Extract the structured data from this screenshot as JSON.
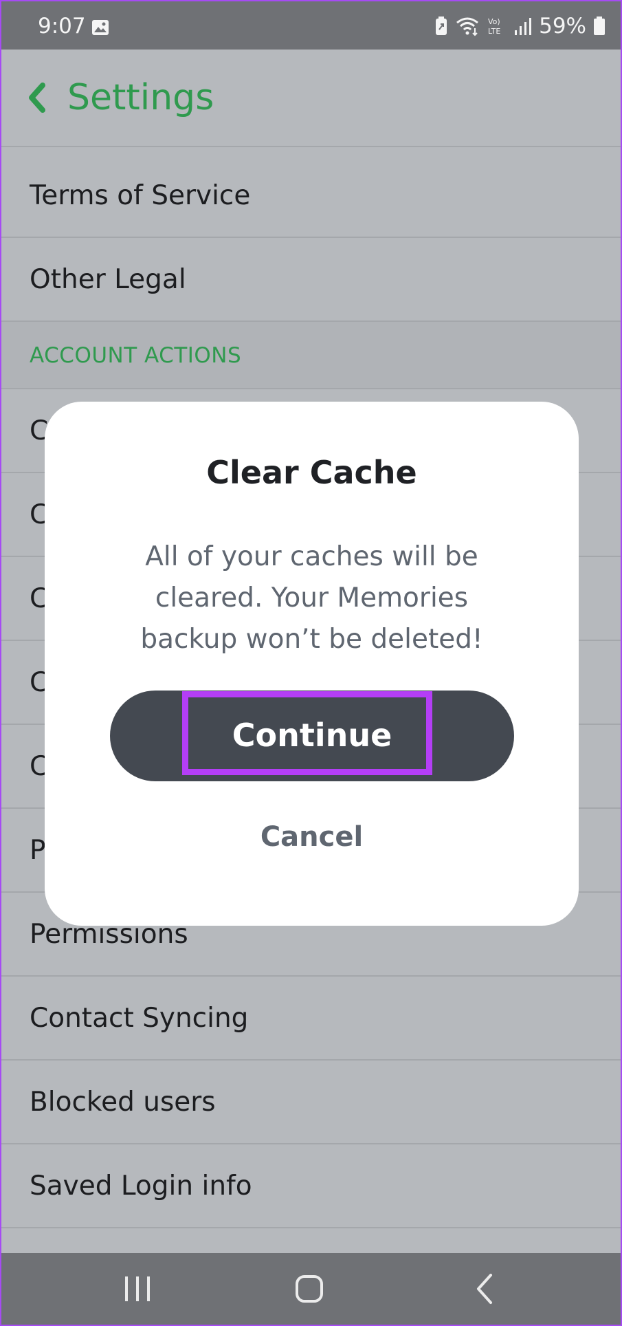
{
  "status_bar": {
    "time": "9:07",
    "battery": "59%",
    "icons": [
      "image-icon",
      "battery-saver-icon",
      "wifi-icon",
      "volte-icon",
      "signal-icon",
      "battery-icon"
    ]
  },
  "header": {
    "title": "Settings",
    "back_icon": "chevron-left-icon"
  },
  "settings_list": {
    "items_top": [
      "Terms of Service",
      "Other Legal"
    ],
    "section_header": "ACCOUNT ACTIONS",
    "items_partial": [
      "C",
      "C",
      "C",
      "C",
      "C",
      "P"
    ],
    "items_bottom": [
      "Permissions",
      "Contact Syncing",
      "Blocked users",
      "Saved Login info"
    ]
  },
  "dialog": {
    "title": "Clear Cache",
    "message": "All of your caches will be cleared. Your Memories backup won’t be deleted!",
    "continue_label": "Continue",
    "cancel_label": "Cancel"
  },
  "nav_bar": {
    "icons": [
      "recent-apps-icon",
      "home-icon",
      "back-icon"
    ]
  },
  "colors": {
    "accent_green": "#2f9a4e",
    "dialog_button": "#444951",
    "highlight_purple": "#b43ef6",
    "dim_background": "#b6b9bd"
  }
}
